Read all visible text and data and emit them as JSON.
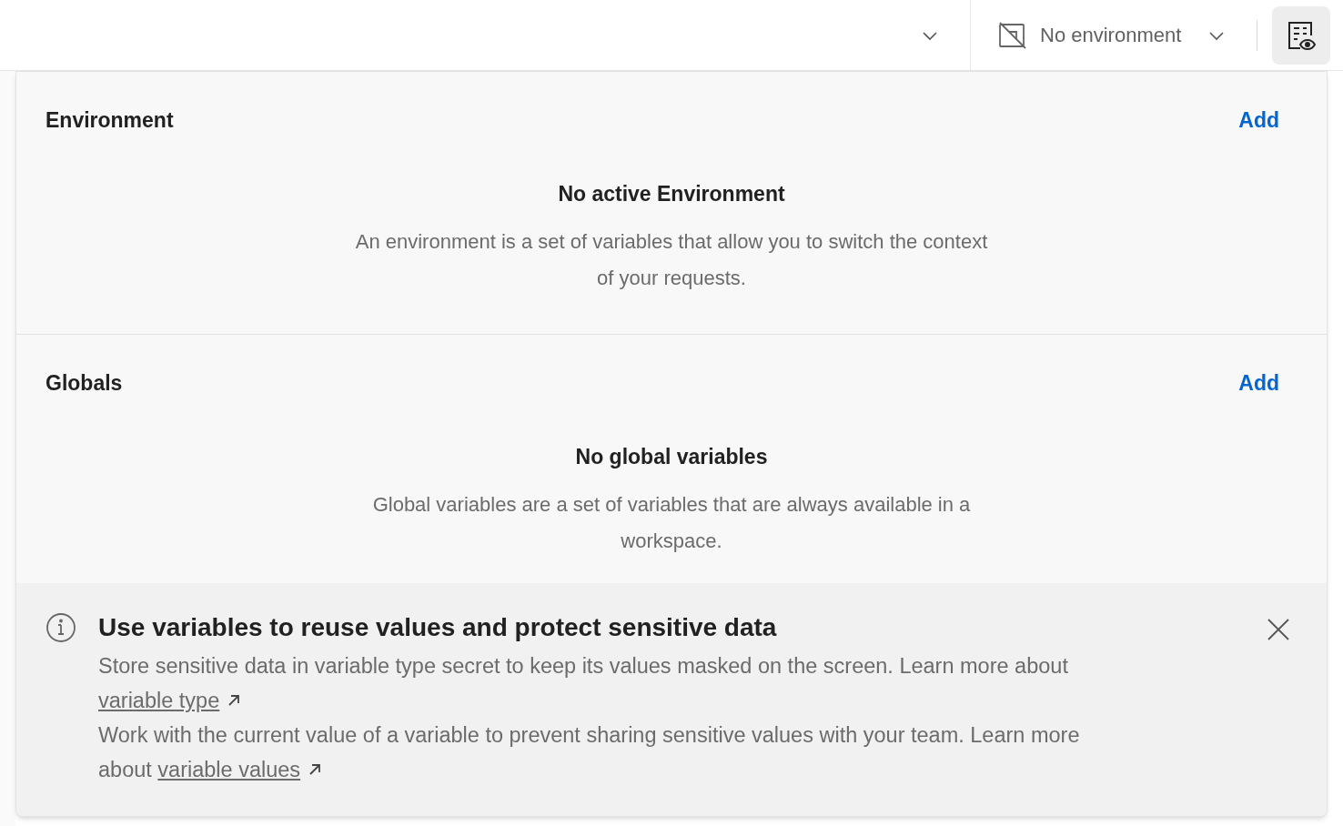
{
  "top_bar": {
    "environment_selector": {
      "label": "No environment"
    },
    "variables_button": {
      "selected": true
    }
  },
  "sections": [
    {
      "title": "Environment",
      "action": "Add",
      "empty_title": "No active Environment",
      "empty_text": "An environment is a set of variables that allow you to switch the context of your requests."
    },
    {
      "title": "Globals",
      "action": "Add",
      "empty_title": "No global variables",
      "empty_text": "Global variables are a set of variables that are always available in a workspace."
    }
  ],
  "tip": {
    "title": "Use variables to reuse values and protect sensitive data",
    "paragraphs": [
      {
        "text": "Store sensitive data in variable type secret to keep its values masked on the screen. Learn more about ",
        "link": "variable type"
      },
      {
        "text": "Work with the current value of a variable to prevent sharing sensitive values with your team. Learn more about ",
        "link": "variable values"
      }
    ]
  }
}
